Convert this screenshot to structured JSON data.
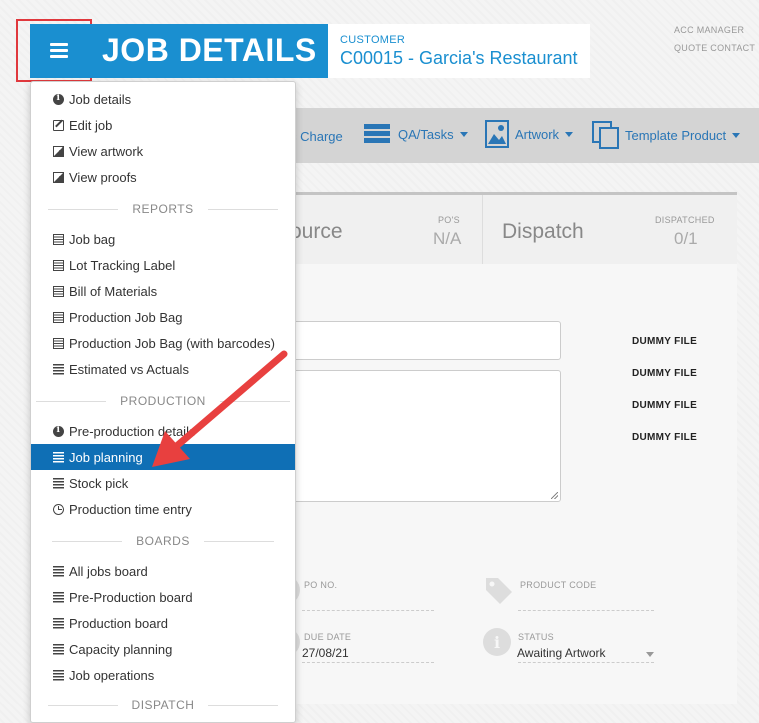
{
  "header": {
    "title": "JOB DETAILS",
    "customer_label": "CUSTOMER",
    "customer_name": "C00015 - Garcia's Restaurant",
    "acc_manager_label": "ACC MANAGER",
    "quote_contact_label": "QUOTE CONTACT"
  },
  "toolbar": {
    "misc_charge": "c Charge",
    "qa_tasks": "QA/Tasks",
    "artwork": "Artwork",
    "template_product": "Template Product"
  },
  "status": {
    "source": "ource",
    "pos_label": "PO'S",
    "pos_value": "N/A",
    "dispatch": "Dispatch",
    "dispatched_label": "DISPATCHED",
    "dispatched_value": "0/1"
  },
  "files": [
    "DUMMY FILE",
    "DUMMY FILE",
    "DUMMY FILE",
    "DUMMY FILE"
  ],
  "fields": {
    "po_no_label": "PO NO.",
    "product_code_label": "PRODUCT CODE",
    "due_date_label": "DUE DATE",
    "due_date_value": "27/08/21",
    "status_label": "STATUS",
    "status_value": "Awaiting Artwork"
  },
  "menu": {
    "top": [
      {
        "label": "Job details",
        "icon": "info-icon"
      },
      {
        "label": "Edit job",
        "icon": "edit-icon"
      },
      {
        "label": "View artwork",
        "icon": "image-icon"
      },
      {
        "label": "View proofs",
        "icon": "image-icon"
      }
    ],
    "reports_header": "REPORTS",
    "reports": [
      {
        "label": "Job bag",
        "icon": "document-icon"
      },
      {
        "label": "Lot Tracking Label",
        "icon": "document-icon"
      },
      {
        "label": "Bill of Materials",
        "icon": "document-icon"
      },
      {
        "label": "Production Job Bag",
        "icon": "document-icon"
      },
      {
        "label": "Production Job Bag (with barcodes)",
        "icon": "document-icon"
      },
      {
        "label": "Estimated vs Actuals",
        "icon": "list-icon"
      }
    ],
    "production_header": "PRODUCTION",
    "production": [
      {
        "label": "Pre-production details",
        "icon": "info-icon"
      },
      {
        "label": "Job planning",
        "icon": "list-icon"
      },
      {
        "label": "Stock pick",
        "icon": "list-icon"
      },
      {
        "label": "Production time entry",
        "icon": "clock-icon"
      }
    ],
    "boards_header": "BOARDS",
    "boards": [
      {
        "label": "All jobs board",
        "icon": "list-icon"
      },
      {
        "label": "Pre-Production board",
        "icon": "list-icon"
      },
      {
        "label": "Production board",
        "icon": "list-icon"
      },
      {
        "label": "Capacity planning",
        "icon": "list-icon"
      },
      {
        "label": "Job operations",
        "icon": "list-icon"
      }
    ],
    "dispatch_header": "DISPATCH"
  },
  "colors": {
    "brand": "#1a8fd0",
    "active_item": "#0f6fb5",
    "highlight_outline": "#e0383d",
    "arrow": "#e8403f"
  }
}
